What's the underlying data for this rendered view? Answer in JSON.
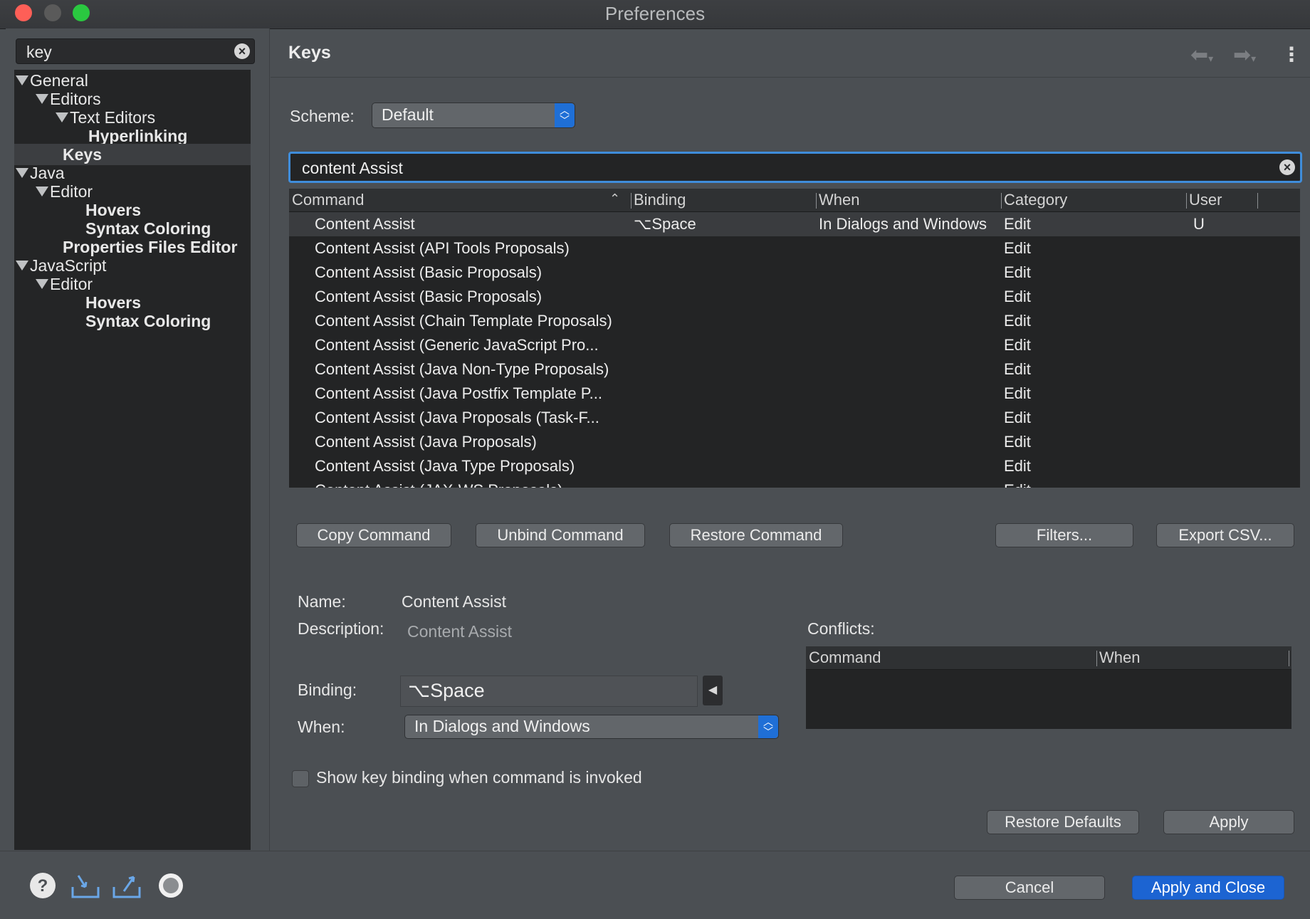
{
  "window": {
    "title": "Preferences"
  },
  "sidebar": {
    "filter_value": "key",
    "items": [
      {
        "label": "General",
        "expanded": true
      },
      {
        "label": "Editors",
        "expanded": true
      },
      {
        "label": "Text Editors",
        "expanded": true
      },
      {
        "label": "Hyperlinking"
      },
      {
        "label": "Keys",
        "selected": true
      },
      {
        "label": "Java",
        "expanded": true
      },
      {
        "label": "Editor",
        "expanded": true
      },
      {
        "label": "Hovers"
      },
      {
        "label": "Syntax Coloring"
      },
      {
        "label": "Properties Files Editor"
      },
      {
        "label": "JavaScript",
        "expanded": true
      },
      {
        "label": "Editor",
        "expanded": true
      },
      {
        "label": "Hovers"
      },
      {
        "label": "Syntax Coloring"
      }
    ]
  },
  "main": {
    "title": "Keys",
    "scheme_label": "Scheme:",
    "scheme_value": "Default",
    "command_filter": "content Assist",
    "table": {
      "columns": [
        "Command",
        "Binding",
        "When",
        "Category",
        "User"
      ],
      "rows": [
        {
          "command": "Content Assist",
          "binding": "⌥Space",
          "when": "In Dialogs and Windows",
          "category": "Edit",
          "user": "U"
        },
        {
          "command": "Content Assist (API Tools Proposals)",
          "binding": "",
          "when": "",
          "category": "Edit",
          "user": ""
        },
        {
          "command": "Content Assist (Basic Proposals)",
          "binding": "",
          "when": "",
          "category": "Edit",
          "user": ""
        },
        {
          "command": "Content Assist (Basic Proposals)",
          "binding": "",
          "when": "",
          "category": "Edit",
          "user": ""
        },
        {
          "command": "Content Assist (Chain Template Proposals)",
          "binding": "",
          "when": "",
          "category": "Edit",
          "user": ""
        },
        {
          "command": "Content Assist (Generic JavaScript Pro...",
          "binding": "",
          "when": "",
          "category": "Edit",
          "user": ""
        },
        {
          "command": "Content Assist (Java Non-Type Proposals)",
          "binding": "",
          "when": "",
          "category": "Edit",
          "user": ""
        },
        {
          "command": "Content Assist (Java Postfix Template P...",
          "binding": "",
          "when": "",
          "category": "Edit",
          "user": ""
        },
        {
          "command": "Content Assist (Java Proposals (Task-F...",
          "binding": "",
          "when": "",
          "category": "Edit",
          "user": ""
        },
        {
          "command": "Content Assist (Java Proposals)",
          "binding": "",
          "when": "",
          "category": "Edit",
          "user": ""
        },
        {
          "command": "Content Assist (Java Type Proposals)",
          "binding": "",
          "when": "",
          "category": "Edit",
          "user": ""
        },
        {
          "command": "Content Assist (JAX-WS Proposals)",
          "binding": "",
          "when": "",
          "category": "Edit",
          "user": ""
        }
      ]
    },
    "buttons": {
      "copy": "Copy Command",
      "unbind": "Unbind Command",
      "restore": "Restore Command",
      "filters": "Filters...",
      "export": "Export CSV..."
    },
    "details": {
      "name_label": "Name:",
      "name_value": "Content Assist",
      "description_label": "Description:",
      "description_value": "Content Assist",
      "binding_label": "Binding:",
      "binding_value": "⌥Space",
      "when_label": "When:",
      "when_value": "In Dialogs and Windows",
      "conflicts_label": "Conflicts:",
      "conflicts_columns": [
        "Command",
        "When"
      ]
    },
    "checkbox_label": "Show key binding when command is invoked",
    "checkbox_checked": false,
    "restore_defaults": "Restore Defaults",
    "apply": "Apply"
  },
  "footer": {
    "cancel": "Cancel",
    "apply_close": "Apply and Close",
    "icons": [
      "help-icon",
      "import-icon",
      "export-icon",
      "record-icon"
    ]
  },
  "colors": {
    "accent": "#1c64d2",
    "focus_ring": "#3f8ddb"
  }
}
